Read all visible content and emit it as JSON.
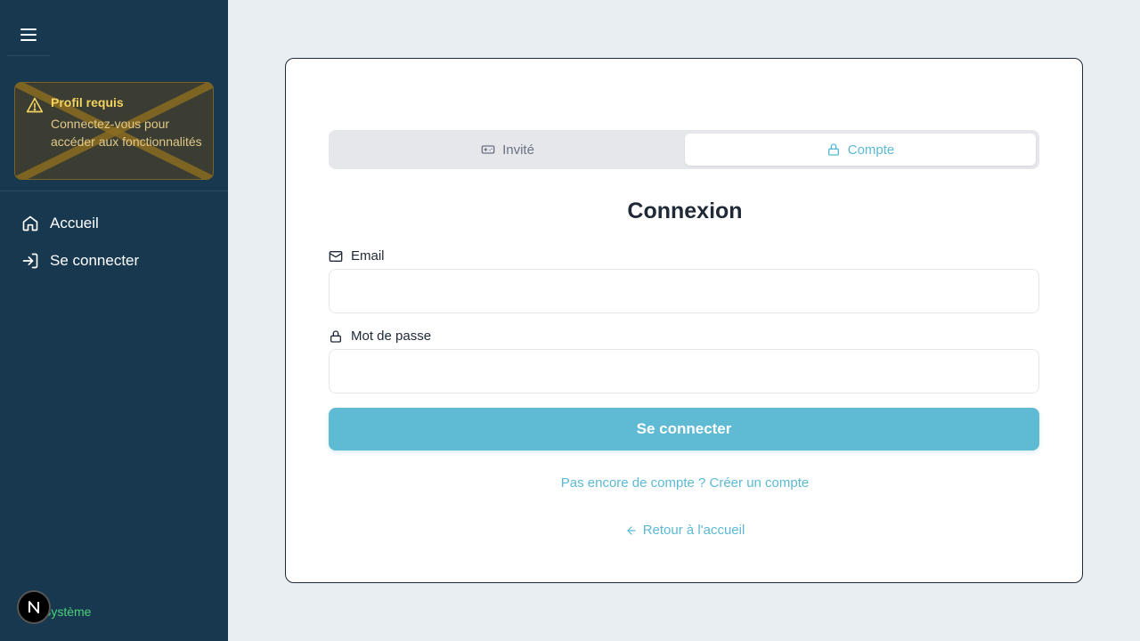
{
  "sidebar": {
    "warning": {
      "title": "Profil requis",
      "text": "Connectez-vous pour accéder aux fonctionnalités"
    },
    "nav": [
      {
        "label": "Accueil",
        "icon": "home-icon"
      },
      {
        "label": "Se connecter",
        "icon": "login-icon"
      }
    ],
    "theme_label": "Système",
    "badge_letter": "N"
  },
  "auth": {
    "tabs": [
      {
        "label": "Invité",
        "icon": "gamepad-icon",
        "active": false
      },
      {
        "label": "Compte",
        "icon": "lock-icon",
        "active": true
      }
    ],
    "title": "Connexion",
    "email_label": "Email",
    "email_value": "",
    "password_label": "Mot de passe",
    "password_value": "",
    "submit_label": "Se connecter",
    "register_link": "Pas encore de compte ? Créer un compte",
    "back_link": "Retour à l'accueil"
  },
  "colors": {
    "sidebar_bg": "#17384e",
    "accent": "#5fbad3",
    "warning": "#f2d25f",
    "theme_green": "#4cd07a"
  }
}
